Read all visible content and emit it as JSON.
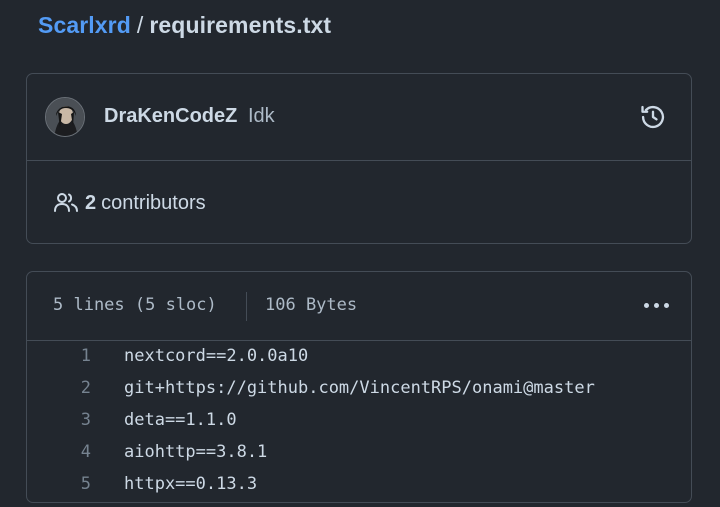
{
  "breadcrumb": {
    "repo": "Scarlxrd",
    "separator": "/",
    "file": "requirements.txt"
  },
  "commit": {
    "author": "DraKenCodeZ",
    "message": "Idk",
    "avatar_icon": "avatar-image",
    "history_icon": "history-clock-icon"
  },
  "contributors": {
    "count": "2",
    "label": "contributors",
    "icon": "people-icon"
  },
  "file": {
    "lines_info": "5 lines (5 sloc)",
    "size": "106 Bytes",
    "menu_icon": "kebab-horizontal-icon",
    "lines": [
      {
        "num": "1",
        "text": "nextcord==2.0.0a10"
      },
      {
        "num": "2",
        "text": "git+https://github.com/VincentRPS/onami@master"
      },
      {
        "num": "3",
        "text": "deta==1.1.0"
      },
      {
        "num": "4",
        "text": "aiohttp==3.8.1"
      },
      {
        "num": "5",
        "text": "httpx==0.13.3"
      }
    ]
  },
  "colors": {
    "background": "#22272e",
    "link": "#539bf5",
    "border": "#444c56",
    "text": "#cdd9e5",
    "muted": "#768390"
  }
}
